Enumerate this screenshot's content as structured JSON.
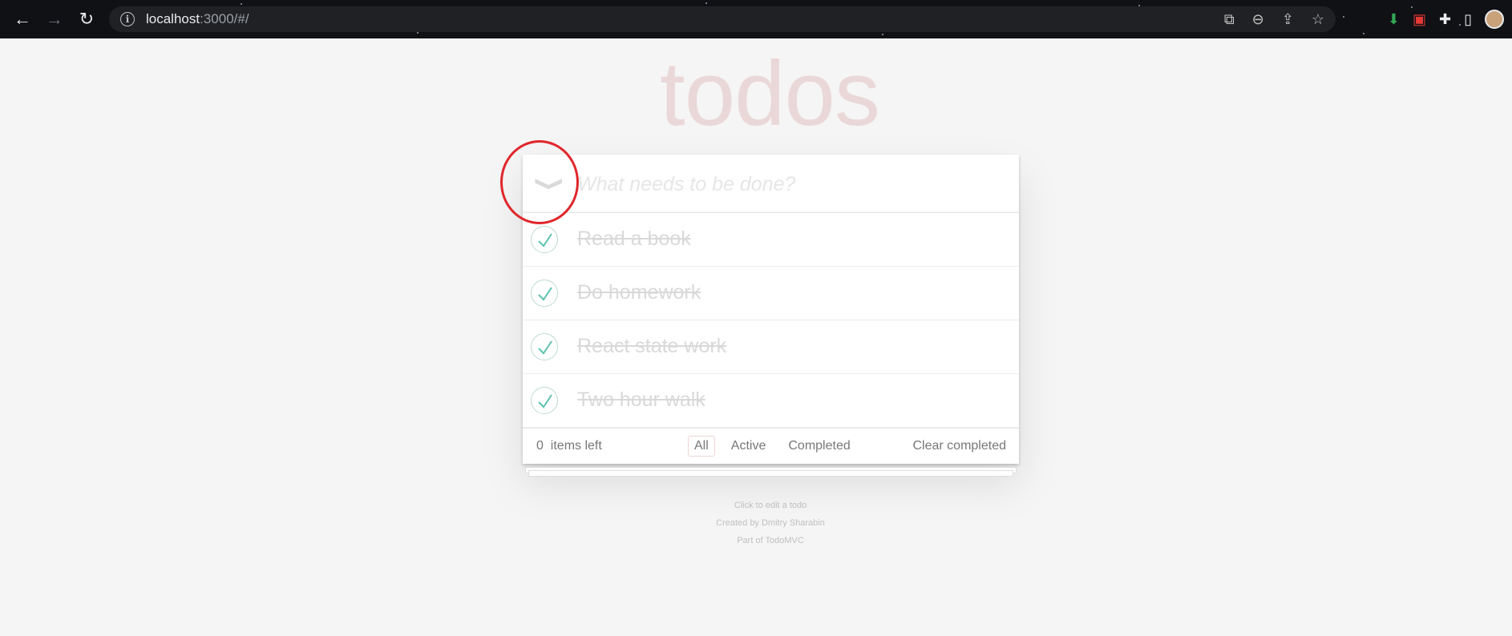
{
  "browser": {
    "url_host": "localhost",
    "url_rest": ":3000/#/",
    "icons": [
      "back-icon",
      "forward-icon",
      "reload-icon",
      "info-icon",
      "translate-icon",
      "zoom-out-icon",
      "share-icon",
      "star-icon",
      "extension-download-icon",
      "extension-red-icon",
      "puzzle-icon",
      "sidebar-icon",
      "profile-avatar"
    ]
  },
  "app": {
    "title": "todos",
    "new_todo_placeholder": "What needs to be done?",
    "toggle_all_glyph": "❯",
    "todos": [
      {
        "text": "Read a book",
        "completed": true
      },
      {
        "text": "Do homework",
        "completed": true
      },
      {
        "text": "React state work",
        "completed": true
      },
      {
        "text": "Two hour walk",
        "completed": true
      }
    ],
    "footer": {
      "count": "0",
      "count_label": "items left",
      "filters": [
        "All",
        "Active",
        "Completed"
      ],
      "selected_filter": "All",
      "clear_label": "Clear completed"
    },
    "info": [
      "Click to edit a todo",
      "Created by Dmitry Sharabin",
      "Part of TodoMVC"
    ]
  },
  "colors": {
    "title": "#eadcdc",
    "check": "#5dc2af",
    "annotation": "#e0262b"
  }
}
